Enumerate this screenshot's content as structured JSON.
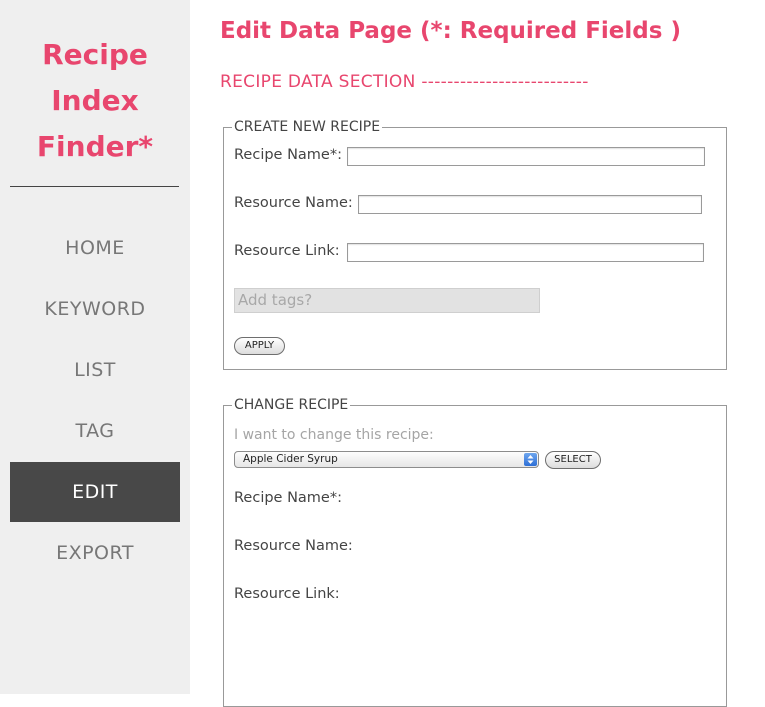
{
  "app": {
    "brand_lines": [
      "Recipe",
      "Index",
      "Finder*"
    ]
  },
  "nav": {
    "items": [
      {
        "label": "HOME"
      },
      {
        "label": "KEYWORD"
      },
      {
        "label": "LIST"
      },
      {
        "label": "TAG"
      },
      {
        "label": "EDIT"
      },
      {
        "label": "EXPORT"
      }
    ],
    "active": "EDIT"
  },
  "page": {
    "title": "Edit Data Page (*: Required Fields )",
    "section_title": "RECIPE DATA SECTION --------------------------"
  },
  "create_form": {
    "legend": "CREATE NEW RECIPE",
    "recipe_name_label": "Recipe Name*:",
    "recipe_name_value": "",
    "resource_name_label": "Resource Name:",
    "resource_name_value": "",
    "resource_link_label": "Resource Link:",
    "resource_link_value": "",
    "tags_placeholder": "Add tags?",
    "apply_label": "APPLY"
  },
  "change_form": {
    "legend": "CHANGE RECIPE",
    "prompt": "I want to change this recipe:",
    "selected_recipe": "Apple Cider Syrup",
    "select_label": "SELECT",
    "recipe_name_label": "Recipe Name*:",
    "resource_name_label": "Resource Name:",
    "resource_link_label": "Resource Link:"
  },
  "colors": {
    "accent": "#e8466e",
    "sidebar_bg": "#efefef",
    "nav_active_bg": "#484848"
  }
}
